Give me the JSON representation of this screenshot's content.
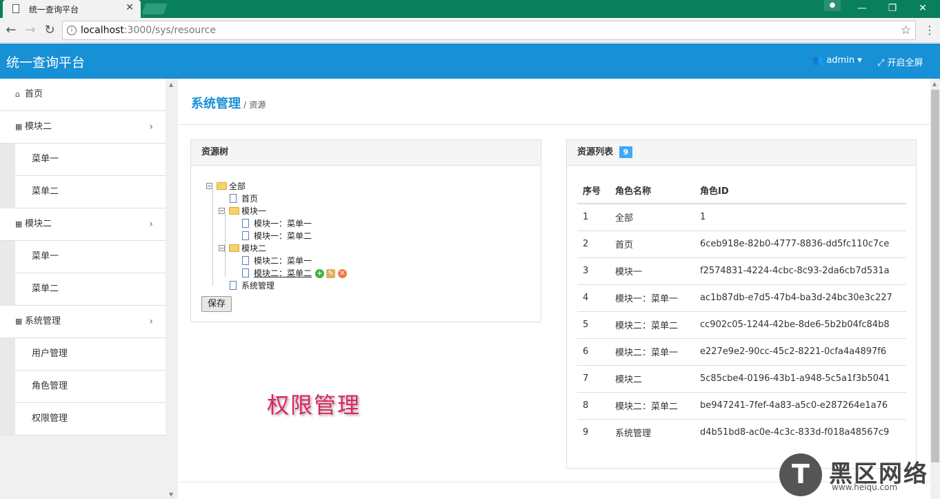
{
  "browser": {
    "tab_title": "统一查询平台",
    "tab_close": "✕",
    "url_host": "localhost",
    "url_rest": ":3000/sys/resource",
    "win_min": "—",
    "win_restore": "❐",
    "win_close": "✕"
  },
  "header": {
    "brand": "统一查询平台",
    "user": "admin",
    "fullscreen": "开启全屏"
  },
  "sidebar": {
    "home": "首页",
    "groups": [
      {
        "label": "模块二",
        "items": [
          "菜单一",
          "菜单二"
        ]
      },
      {
        "label": "模块二",
        "items": [
          "菜单一",
          "菜单二"
        ]
      },
      {
        "label": "系统管理",
        "items": [
          "用户管理",
          "角色管理",
          "权限管理"
        ]
      }
    ]
  },
  "breadcrumb": {
    "section": "系统管理",
    "separator": "/",
    "page": "资源"
  },
  "tree_panel": {
    "title": "资源树",
    "nodes": [
      "全部",
      "首页",
      "模块一",
      "模块一：菜单一",
      "模块一：菜单二",
      "模块二",
      "模块二：菜单一",
      "模块二：菜单二",
      "系统管理"
    ],
    "save_label": "保存"
  },
  "list_panel": {
    "title": "资源列表",
    "count": "9",
    "columns": [
      "序号",
      "角色名称",
      "角色ID"
    ],
    "rows": [
      [
        "1",
        "全部",
        "1"
      ],
      [
        "2",
        "首页",
        "6ceb918e-82b0-4777-8836-dd5fc110c7ce"
      ],
      [
        "3",
        "模块一",
        "f2574831-4224-4cbc-8c93-2da6cb7d531a"
      ],
      [
        "4",
        "模块一：菜单一",
        "ac1b87db-e7d5-47b4-ba3d-24bc30e3c227"
      ],
      [
        "5",
        "模块二：菜单二",
        "cc902c05-1244-42be-8de6-5b2b04fc84b8"
      ],
      [
        "6",
        "模块二：菜单一",
        "e227e9e2-90cc-45c2-8221-0cfa4a4897f6"
      ],
      [
        "7",
        "模块二",
        "5c85cbe4-0196-43b1-a948-5c5a1f3b5041"
      ],
      [
        "8",
        "模块二：菜单二",
        "be947241-7fef-4a83-a5c0-e287264e1a76"
      ],
      [
        "9",
        "系统管理",
        "d4b51bd8-ac0e-4c3c-833d-f018a48567c9"
      ]
    ]
  },
  "overlay_text": "权限管理",
  "logo": {
    "mark": "T",
    "cn": "黑区网络",
    "en": "www.heiqu.com"
  },
  "colors": {
    "accent": "#1890d6",
    "chrome": "#0a7f5c",
    "badge": "#3fa9f5",
    "overlay": "#e0245e"
  }
}
